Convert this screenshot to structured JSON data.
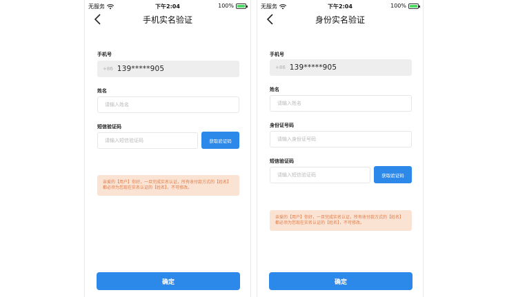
{
  "status_bar": {
    "carrier": "无服务",
    "time": "下午2:04",
    "battery": "100%"
  },
  "screens": [
    {
      "title": "手机实名验证",
      "phone_label": "手机号",
      "country_code": "+86",
      "phone_number": "139*****905",
      "name_label": "姓名",
      "name_placeholder": "请输入姓名",
      "sms_label": "短信验证码",
      "sms_placeholder": "请输入短信验证码",
      "sms_button": "获取验证码",
      "notice": "亲爱的【用户】你好，一旦完成实名认证，所有收付款方式的【姓名】都必须为您现在实名认证的【姓名】，不可修改。",
      "confirm_button": "确定"
    },
    {
      "title": "身份实名验证",
      "phone_label": "手机号",
      "country_code": "+86",
      "phone_number": "139*****905",
      "name_label": "姓名",
      "name_placeholder": "请输入姓名",
      "id_label": "身份证号码",
      "id_placeholder": "请输入身份证号码",
      "sms_label": "短信验证码",
      "sms_placeholder": "请输入短信验证码",
      "sms_button": "获取验证码",
      "notice": "亲爱的【用户】你好，一旦完成实名认证，所有收付款方式的【姓名】都必须为您现在实名认证的【姓名】，不可修改。",
      "confirm_button": "确定"
    }
  ],
  "colors": {
    "accent": "#2c88e9",
    "notice_bg": "#fbe3d4",
    "notice_text": "#e07b46"
  },
  "icons": [
    "wifi-icon",
    "battery-icon",
    "back-arrow-icon"
  ]
}
